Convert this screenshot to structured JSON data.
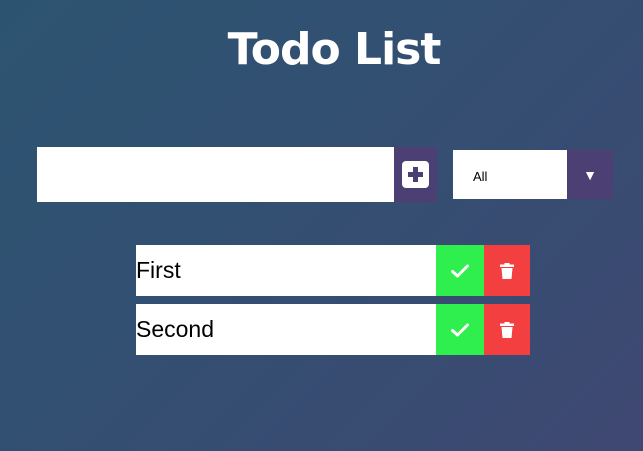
{
  "header": {
    "title": "Todo List"
  },
  "form": {
    "input_value": "",
    "add_icon": "plus-square-icon",
    "filter": {
      "selected": "All",
      "options": [
        "All"
      ],
      "icon": "triangle-down-icon"
    }
  },
  "todos": [
    {
      "text": "First",
      "complete_icon": "check-icon",
      "delete_icon": "trash-icon"
    },
    {
      "text": "Second",
      "complete_icon": "check-icon",
      "delete_icon": "trash-icon"
    }
  ],
  "colors": {
    "accent": "#4b3f74",
    "complete": "#2fef4e",
    "delete": "#f33f3f",
    "background_start": "#2c5470",
    "background_end": "#3f4872"
  }
}
